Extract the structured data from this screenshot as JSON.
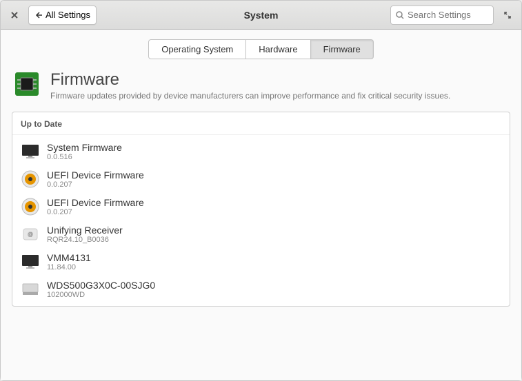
{
  "header": {
    "title": "System",
    "back_label": "All Settings",
    "search_placeholder": "Search Settings"
  },
  "tabs": [
    {
      "label": "Operating System"
    },
    {
      "label": "Hardware"
    },
    {
      "label": "Firmware",
      "active": true
    }
  ],
  "page": {
    "title": "Firmware",
    "description": "Firmware updates provided by device manufacturers can improve performance and fix critical security issues."
  },
  "section_header": "Up to Date",
  "devices": [
    {
      "name": "System Firmware",
      "version": "0.0.516",
      "icon": "monitor"
    },
    {
      "name": "UEFI Device Firmware",
      "version": "0.0.207",
      "icon": "speaker"
    },
    {
      "name": "UEFI Device Firmware",
      "version": "0.0.207",
      "icon": "speaker"
    },
    {
      "name": "Unifying Receiver",
      "version": "RQR24.10_B0036",
      "icon": "dongle"
    },
    {
      "name": "VMM4131",
      "version": "11.84.00",
      "icon": "monitor"
    },
    {
      "name": "WDS500G3X0C-00SJG0",
      "version": "102000WD",
      "icon": "drive"
    }
  ]
}
